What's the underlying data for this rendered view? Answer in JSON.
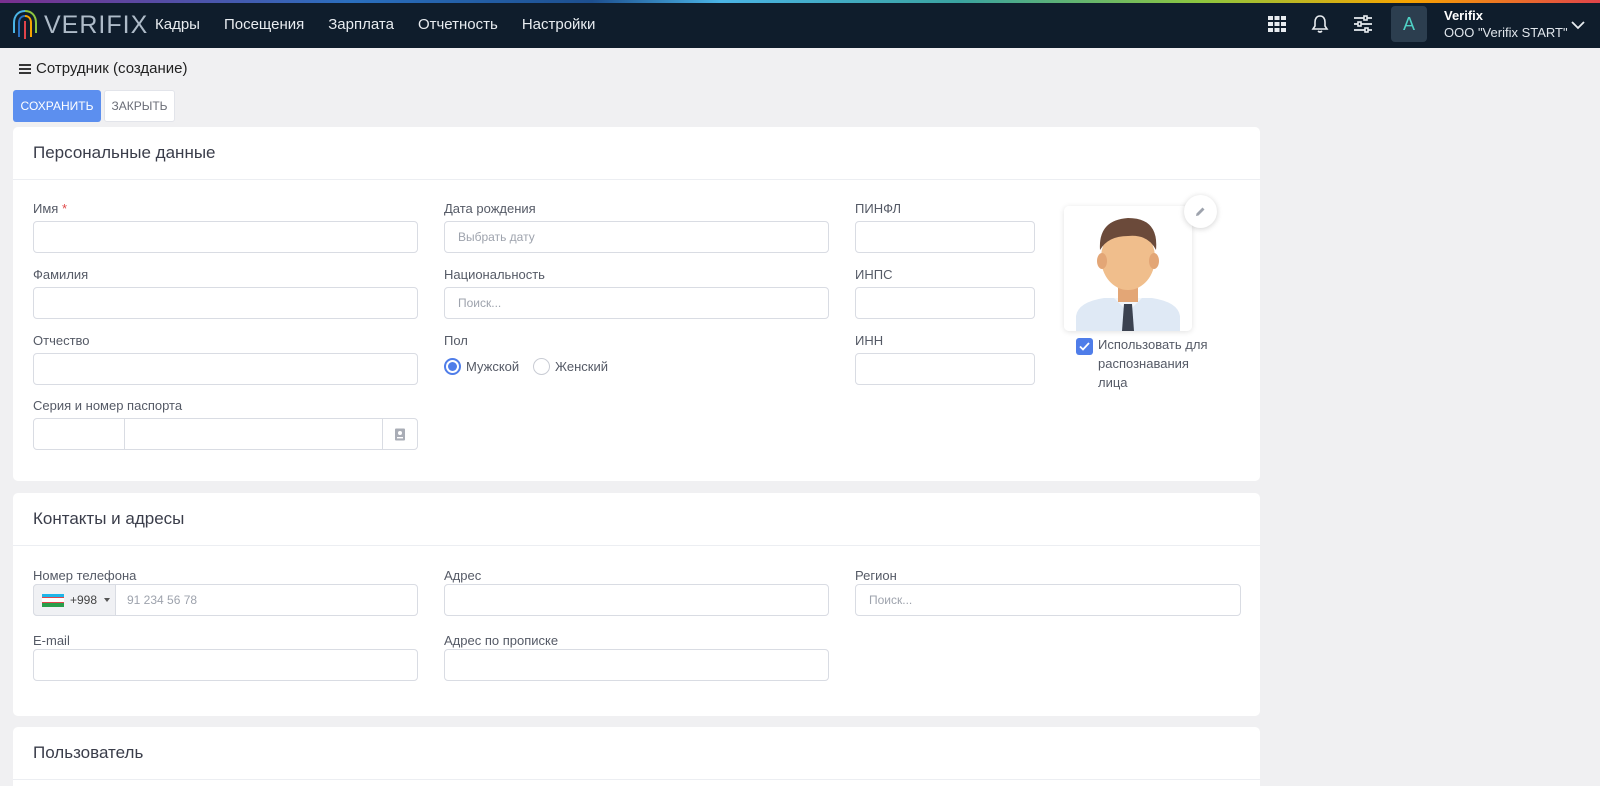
{
  "app": {
    "logo_text": "VERIFIX",
    "menu": [
      "Кадры",
      "Посещения",
      "Зарплата",
      "Отчетность",
      "Настройки"
    ],
    "icons": [
      "apps-grid-icon",
      "bell-icon",
      "sliders-icon"
    ],
    "avatar_letter": "A",
    "user_name": "Verifix",
    "user_company": "ООО \"Verifix START\""
  },
  "page": {
    "title": "Сотрудник (создание)",
    "save_label": "СОХРАНИТЬ",
    "close_label": "ЗАКРЫТЬ"
  },
  "personal": {
    "heading": "Персональные данные",
    "first_name_label": "Имя",
    "required_mark": "*",
    "last_name_label": "Фамилия",
    "middle_name_label": "Отчество",
    "passport_label": "Серия и номер паспорта",
    "birth_label": "Дата рождения",
    "birth_placeholder": "Выбрать дату",
    "nationality_label": "Национальность",
    "nationality_placeholder": "Поиск...",
    "gender_label": "Пол",
    "gender_male": "Мужской",
    "gender_female": "Женский",
    "gender_selected": "Мужской",
    "pinfl_label": "ПИНФЛ",
    "inps_label": "ИНПС",
    "inn_label": "ИНН",
    "face_checkbox_label": "Использовать для распознавания лица",
    "face_checkbox_checked": true
  },
  "contacts": {
    "heading": "Контакты и адресы",
    "phone_label": "Номер телефона",
    "phone_code": "+998",
    "phone_placeholder": "91 234 56 78",
    "email_label": "E-mail",
    "address_label": "Адрес",
    "reg_address_label": "Адрес по прописке",
    "region_label": "Регион",
    "region_placeholder": "Поиск..."
  },
  "user_section": {
    "heading": "Пользователь"
  },
  "colors": {
    "primary": "#5c8fef",
    "nav_bg": "#0f1d2c",
    "accent_teal": "#4fd1c5"
  }
}
